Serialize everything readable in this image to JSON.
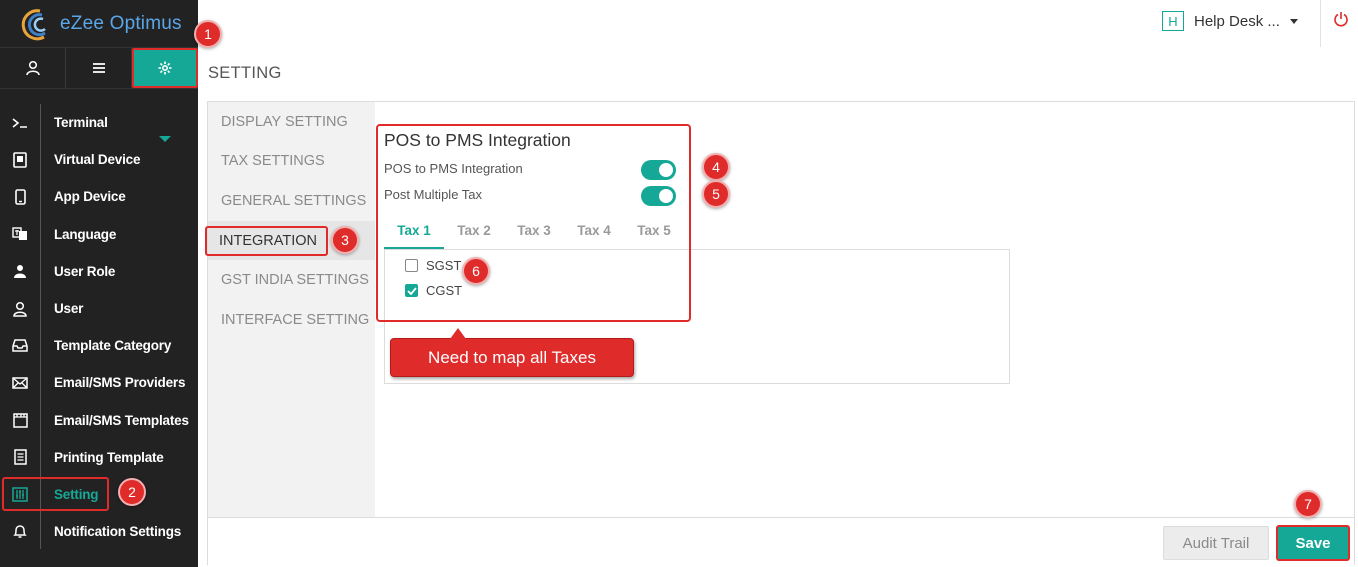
{
  "app": {
    "name": "eZee Optimus"
  },
  "header": {
    "help_box": "H",
    "help_label": "Help Desk ...",
    "power": "power-icon"
  },
  "top_tabs": [
    {
      "name": "user-icon"
    },
    {
      "name": "list-icon"
    },
    {
      "name": "gear-icon",
      "active": true
    }
  ],
  "sidebar": {
    "items": [
      {
        "label": "Terminal",
        "icon": "terminal-icon"
      },
      {
        "label": "Virtual Device",
        "icon": "virtual-device-icon"
      },
      {
        "label": "App Device",
        "icon": "app-device-icon"
      },
      {
        "label": "Language",
        "icon": "language-icon"
      },
      {
        "label": "User Role",
        "icon": "user-role-icon"
      },
      {
        "label": "User",
        "icon": "user-icon"
      },
      {
        "label": "Template Category",
        "icon": "inbox-icon"
      },
      {
        "label": "Email/SMS Providers",
        "icon": "envelope-icon"
      },
      {
        "label": "Email/SMS Templates",
        "icon": "film-icon"
      },
      {
        "label": "Printing Template",
        "icon": "printer-icon"
      },
      {
        "label": "Setting",
        "icon": "sliders-icon",
        "active": true
      },
      {
        "label": "Notification Settings",
        "icon": "bell-icon"
      }
    ]
  },
  "page": {
    "title": "SETTING"
  },
  "subnav": {
    "items": [
      {
        "label": "DISPLAY SETTING"
      },
      {
        "label": "TAX SETTINGS"
      },
      {
        "label": "GENERAL SETTINGS"
      },
      {
        "label": "INTEGRATION",
        "active": true
      },
      {
        "label": "GST INDIA SETTINGS"
      },
      {
        "label": "INTERFACE SETTING"
      }
    ]
  },
  "integration": {
    "title": "POS to PMS Integration",
    "toggles": [
      {
        "label": "POS to PMS Integration",
        "on": true
      },
      {
        "label": "Post Multiple Tax",
        "on": true
      }
    ],
    "tabs": [
      "Tax 1",
      "Tax 2",
      "Tax 3",
      "Tax 4",
      "Tax 5"
    ],
    "active_tab": "Tax 1",
    "taxes": [
      {
        "label": "SGST",
        "checked": false
      },
      {
        "label": "CGST",
        "checked": true
      }
    ]
  },
  "callout": {
    "text": "Need to map all Taxes"
  },
  "footer": {
    "audit_label": "Audit Trail",
    "save_label": "Save"
  },
  "badges": [
    "1",
    "2",
    "3",
    "4",
    "5",
    "6",
    "7"
  ],
  "colors": {
    "accent": "#16a896",
    "annotation": "#e02b2b",
    "sidebar_bg": "#222222",
    "logo_blue": "#5aa6e8"
  }
}
